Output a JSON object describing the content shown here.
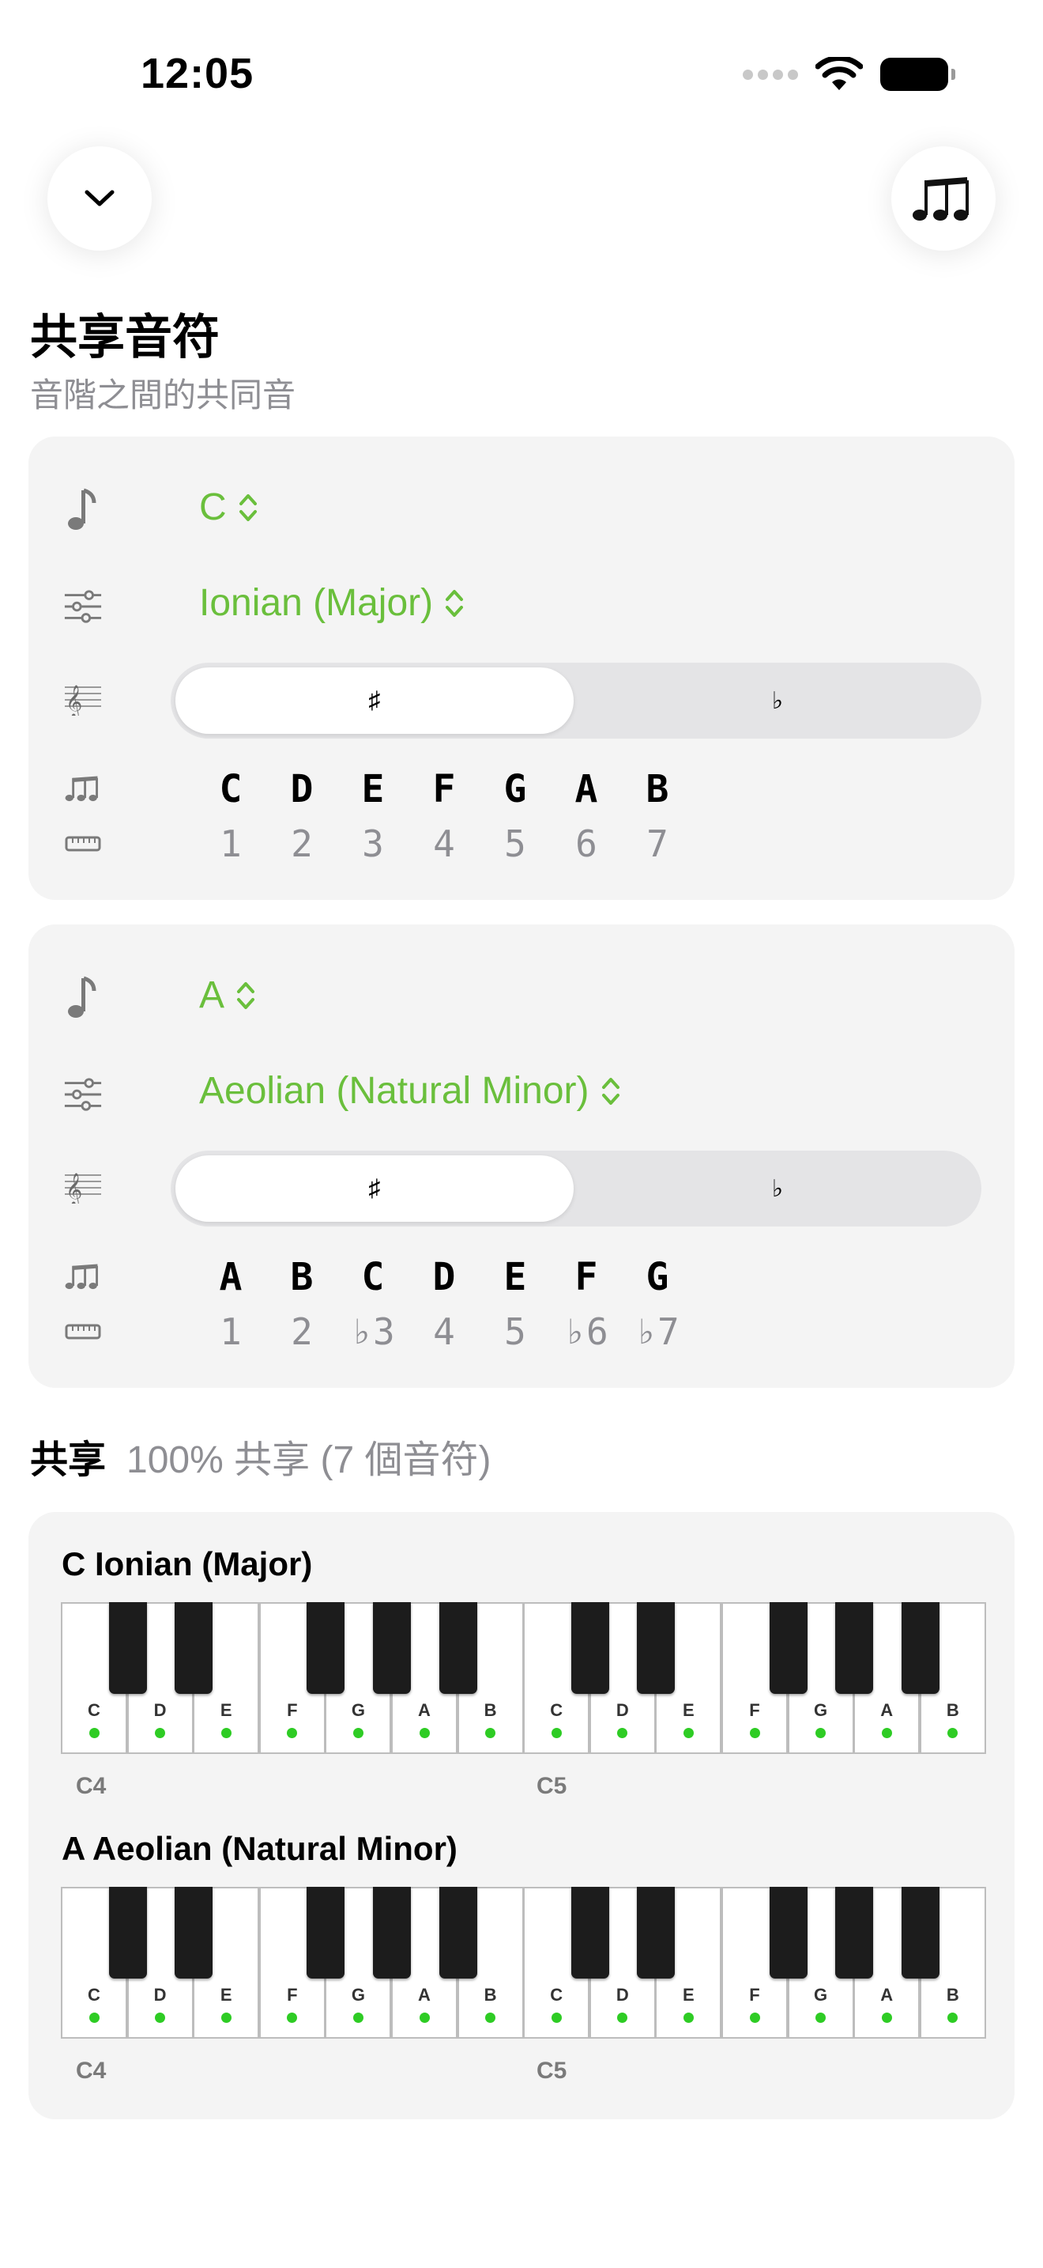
{
  "status_bar": {
    "time": "12:05"
  },
  "header": {
    "collapse_icon": "chevron-down-icon",
    "notes_icon": "musical-notes-icon",
    "title": "共享音符",
    "subtitle": "音階之間的共同音"
  },
  "scales": [
    {
      "root": "C",
      "mode": "Ionian (Major)",
      "accidental_options": [
        "♯",
        "♭"
      ],
      "selected_accidental": "♯",
      "notes": [
        "C",
        "D",
        "E",
        "F",
        "G",
        "A",
        "B"
      ],
      "degrees": [
        "1",
        "2",
        "3",
        "4",
        "5",
        "6",
        "7"
      ]
    },
    {
      "root": "A",
      "mode": "Aeolian (Natural Minor)",
      "accidental_options": [
        "♯",
        "♭"
      ],
      "selected_accidental": "♯",
      "notes": [
        "A",
        "B",
        "C",
        "D",
        "E",
        "F",
        "G"
      ],
      "degrees": [
        "1",
        "2",
        "♭3",
        "4",
        "5",
        "♭6",
        "♭7"
      ]
    }
  ],
  "shared": {
    "label": "共享",
    "detail": "100% 共享 (7 個音符)"
  },
  "keyboards": [
    {
      "title": "C Ionian (Major)",
      "keys": [
        "C",
        "D",
        "E",
        "F",
        "G",
        "A",
        "B",
        "C",
        "D",
        "E",
        "F",
        "G",
        "A",
        "B"
      ],
      "octave_labels": [
        "C4",
        "C5"
      ]
    },
    {
      "title": "A Aeolian (Natural Minor)",
      "keys": [
        "C",
        "D",
        "E",
        "F",
        "G",
        "A",
        "B",
        "C",
        "D",
        "E",
        "F",
        "G",
        "A",
        "B"
      ],
      "octave_labels": [
        "C4",
        "C5"
      ]
    }
  ],
  "colors": {
    "accent": "#6abf3c",
    "highlight_dot": "#2ecc24",
    "secondary_text": "#8e8e93",
    "card_background": "#f4f4f4"
  }
}
